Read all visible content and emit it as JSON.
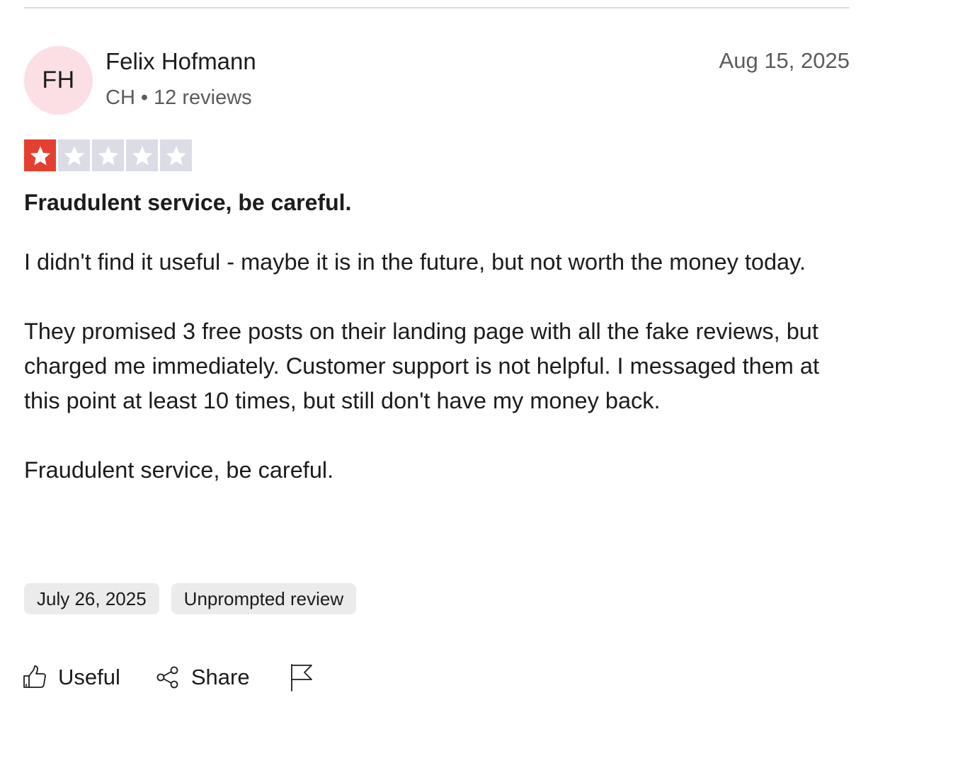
{
  "reviewer": {
    "initials": "FH",
    "name": "Felix Hofmann",
    "country": "CH",
    "separator": "•",
    "review_count": "12 reviews"
  },
  "review": {
    "date": "Aug 15, 2025",
    "rating": 1,
    "rating_max": 5,
    "title": "Fraudulent service, be careful.",
    "paragraphs": [
      "I didn't find it useful - maybe it is in the future, but not worth the money today.",
      "They promised 3 free posts on their landing page with all the fake reviews, but charged me immediately. Customer support is not helpful. I messaged them at this point at least 10 times, but still don't have my money back.",
      "Fraudulent service, be careful."
    ],
    "experience_date": "July 26, 2025",
    "tag": "Unprompted review"
  },
  "actions": {
    "useful_label": "Useful",
    "share_label": "Share",
    "useful_icon": "thumbs-up-icon",
    "share_icon": "share-icon",
    "report_icon": "flag-icon"
  },
  "colors": {
    "star_filled": "#e5402f",
    "star_empty": "#dcdce6",
    "avatar_bg": "#fbdfe5",
    "tag_bg": "#ebebeb"
  }
}
